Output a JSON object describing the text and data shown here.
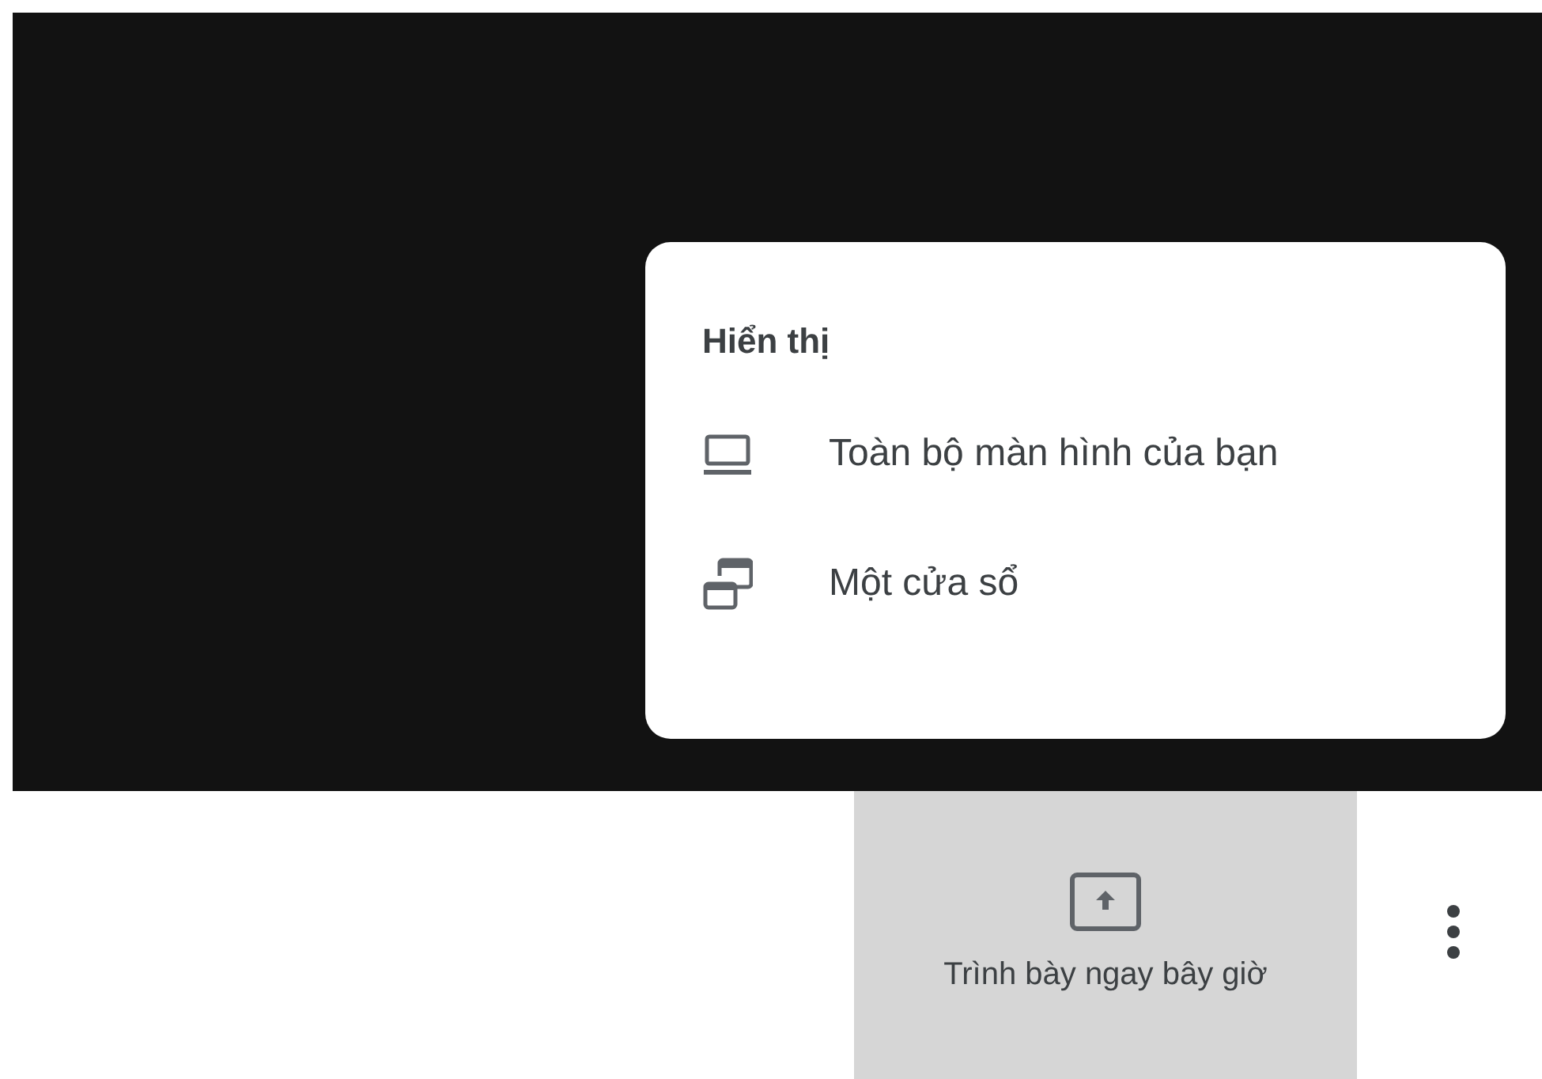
{
  "menu": {
    "title": "Hiển thị",
    "items": [
      {
        "kind": "screen",
        "label": "Toàn bộ màn hình của bạn"
      },
      {
        "kind": "window",
        "label": "Một cửa sổ"
      }
    ]
  },
  "present_button": {
    "label": "Trình bày ngay bây giờ"
  }
}
